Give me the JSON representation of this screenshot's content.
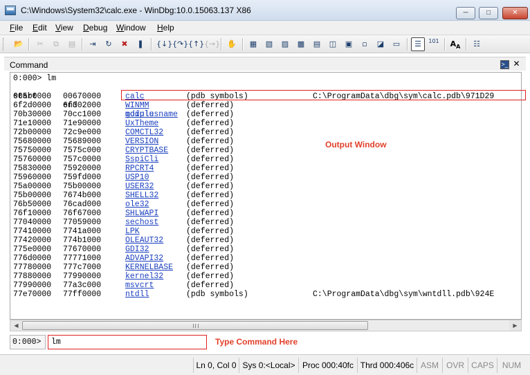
{
  "window": {
    "title": "C:\\Windows\\System32\\calc.exe - WinDbg:10.0.15063.137 X86",
    "minimize_glyph": "─",
    "maximize_glyph": "□",
    "close_glyph": "✕"
  },
  "menu": [
    {
      "label": "File",
      "accel": "F"
    },
    {
      "label": "Edit",
      "accel": "E"
    },
    {
      "label": "View",
      "accel": "V"
    },
    {
      "label": "Debug",
      "accel": "D"
    },
    {
      "label": "Window",
      "accel": "W"
    },
    {
      "label": "Help",
      "accel": "H"
    }
  ],
  "toolbar": {
    "icons": [
      "open-folder-icon",
      "cut-icon",
      "copy-icon",
      "paste-icon",
      "go-icon",
      "restart-icon",
      "stop-debugging-icon",
      "break-icon",
      "step-into-icon",
      "step-over-icon",
      "step-out-icon",
      "run-to-cursor-icon",
      "set-breakpoint-icon",
      "command-window-icon",
      "watch-window-icon",
      "locals-window-icon",
      "registers-window-icon",
      "memory-window-icon",
      "call-stack-icon",
      "disassembly-window-icon",
      "scratch-pad-icon",
      "source-mode-icon",
      "font-icon",
      "options-icon"
    ],
    "source_mode_label": "101"
  },
  "command_pane": {
    "title": "Command",
    "prompt_line": "0:000> lm",
    "columns": {
      "start": "start",
      "end": "end",
      "module": "module name"
    },
    "rows": [
      {
        "start": "005b0000",
        "end": "00670000",
        "module": "calc",
        "status": "(pdb symbols)",
        "path": "C:\\ProgramData\\dbg\\sym\\calc.pdb\\971D29"
      },
      {
        "start": "6f2d0000",
        "end": "6f302000",
        "module": "WINMM",
        "status": "(deferred)",
        "path": ""
      },
      {
        "start": "70b30000",
        "end": "70cc1000",
        "module": "gdiplus",
        "status": "(deferred)",
        "path": ""
      },
      {
        "start": "71e10000",
        "end": "71e90000",
        "module": "UxTheme",
        "status": "(deferred)",
        "path": ""
      },
      {
        "start": "72b00000",
        "end": "72c9e000",
        "module": "COMCTL32",
        "status": "(deferred)",
        "path": ""
      },
      {
        "start": "75680000",
        "end": "75689000",
        "module": "VERSION",
        "status": "(deferred)",
        "path": ""
      },
      {
        "start": "75750000",
        "end": "7575c000",
        "module": "CRYPTBASE",
        "status": "(deferred)",
        "path": ""
      },
      {
        "start": "75760000",
        "end": "757c0000",
        "module": "SspiCli",
        "status": "(deferred)",
        "path": ""
      },
      {
        "start": "75830000",
        "end": "75920000",
        "module": "RPCRT4",
        "status": "(deferred)",
        "path": ""
      },
      {
        "start": "75960000",
        "end": "759fd000",
        "module": "USP10",
        "status": "(deferred)",
        "path": ""
      },
      {
        "start": "75a00000",
        "end": "75b00000",
        "module": "USER32",
        "status": "(deferred)",
        "path": ""
      },
      {
        "start": "75b00000",
        "end": "7674b000",
        "module": "SHELL32",
        "status": "(deferred)",
        "path": ""
      },
      {
        "start": "76b50000",
        "end": "76cad000",
        "module": "ole32",
        "status": "(deferred)",
        "path": ""
      },
      {
        "start": "76f10000",
        "end": "76f67000",
        "module": "SHLWAPI",
        "status": "(deferred)",
        "path": ""
      },
      {
        "start": "77040000",
        "end": "77059000",
        "module": "sechost",
        "status": "(deferred)",
        "path": ""
      },
      {
        "start": "77410000",
        "end": "7741a000",
        "module": "LPK",
        "status": "(deferred)",
        "path": ""
      },
      {
        "start": "77420000",
        "end": "774b1000",
        "module": "OLEAUT32",
        "status": "(deferred)",
        "path": ""
      },
      {
        "start": "775e0000",
        "end": "77670000",
        "module": "GDI32",
        "status": "(deferred)",
        "path": ""
      },
      {
        "start": "776d0000",
        "end": "77771000",
        "module": "ADVAPI32",
        "status": "(deferred)",
        "path": ""
      },
      {
        "start": "77780000",
        "end": "777c7000",
        "module": "KERNELBASE",
        "status": "(deferred)",
        "path": ""
      },
      {
        "start": "77880000",
        "end": "77990000",
        "module": "kernel32",
        "status": "(deferred)",
        "path": ""
      },
      {
        "start": "77990000",
        "end": "77a3c000",
        "module": "msvcrt",
        "status": "(deferred)",
        "path": ""
      },
      {
        "start": "77e70000",
        "end": "77ff0000",
        "module": "ntdll",
        "status": "(pdb symbols)",
        "path": "C:\\ProgramData\\dbg\\sym\\wntdll.pdb\\924E"
      }
    ],
    "output_annotation": "Output Window",
    "input_prompt": "0:000>",
    "input_value": "lm",
    "input_annotation": "Type Command Here"
  },
  "statusbar": {
    "position": "Ln 0, Col 0",
    "sys": "Sys 0:<Local>",
    "proc": "Proc 000:40fc",
    "thrd": "Thrd 000:406c",
    "asm": "ASM",
    "ovr": "OVR",
    "caps": "CAPS",
    "num": "NUM"
  },
  "colors": {
    "annotation": "#e2402a",
    "highlight_border": "#e02020",
    "link": "#1a3fbf"
  }
}
